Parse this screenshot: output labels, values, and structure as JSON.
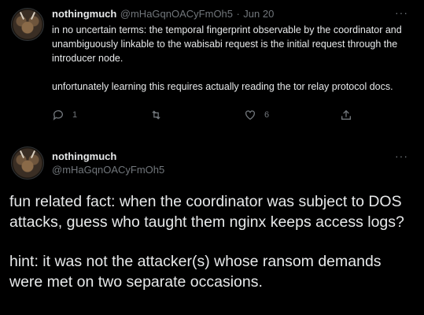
{
  "tweet1": {
    "name": "nothingmuch",
    "handle": "@mHaGqnOACyFmOh5",
    "sep": "·",
    "date": "Jun 20",
    "para1": "in no uncertain terms: the temporal fingerprint observable by the coordinator and unambiguously linkable to the wabisabi request is the initial request through the introducer node.",
    "para2": "unfortunately learning this requires actually reading the tor relay protocol docs.",
    "reply_count": "1",
    "retweet_count": "",
    "like_count": "6",
    "icons": [
      "reply-icon",
      "retweet-icon",
      "like-icon",
      "share-icon",
      "more-icon"
    ]
  },
  "tweet2": {
    "name": "nothingmuch",
    "handle": "@mHaGqnOACyFmOh5",
    "para1": "fun related fact: when the coordinator was subject to DOS attacks, guess who taught them nginx keeps access logs?",
    "para2": "hint: it was not the attacker(s) whose ransom demands were met on two separate occasions."
  },
  "more_glyph": "···",
  "colors": {
    "background": "#000000",
    "text": "#e7e9ea",
    "muted": "#71767b"
  }
}
